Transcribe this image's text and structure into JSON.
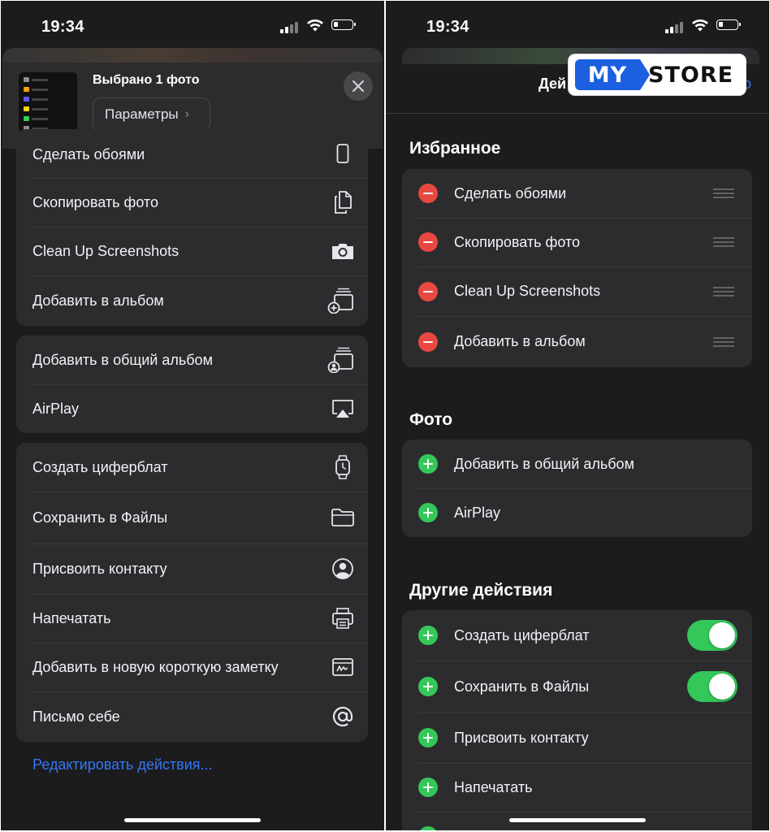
{
  "status": {
    "time": "19:34"
  },
  "share_sheet": {
    "selection_title": "Выбрано 1 фото",
    "params_label": "Параметры",
    "groups": [
      {
        "items": [
          {
            "label": "Сделать обоями",
            "icon": "phone-icon"
          },
          {
            "label": "Скопировать фото",
            "icon": "copy-icon"
          },
          {
            "label": "Clean Up Screenshots",
            "icon": "camera-icon"
          },
          {
            "label": "Добавить в альбом",
            "icon": "add-album-icon"
          }
        ]
      },
      {
        "items": [
          {
            "label": "Добавить в общий альбом",
            "icon": "shared-album-icon"
          },
          {
            "label": "AirPlay",
            "icon": "airplay-icon"
          }
        ]
      },
      {
        "items": [
          {
            "label": "Создать циферблат",
            "icon": "watch-icon"
          },
          {
            "label": "Сохранить в Файлы",
            "icon": "folder-icon"
          },
          {
            "label": "Присвоить контакту",
            "icon": "contact-icon"
          },
          {
            "label": "Напечатать",
            "icon": "printer-icon"
          },
          {
            "label": "Добавить в новую короткую заметку",
            "icon": "quick-note-icon"
          },
          {
            "label": "Письмо себе",
            "icon": "at-icon"
          }
        ]
      }
    ],
    "edit_actions_link": "Редактировать действия..."
  },
  "edit_actions": {
    "nav_title": "Дей",
    "nav_done": "о",
    "sections": [
      {
        "title": "Избранное",
        "items": [
          {
            "label": "Сделать обоями",
            "badge": "minus"
          },
          {
            "label": "Скопировать фото",
            "badge": "minus"
          },
          {
            "label": "Clean Up Screenshots",
            "badge": "minus"
          },
          {
            "label": "Добавить в альбом",
            "badge": "minus"
          }
        ]
      },
      {
        "title": "Фото",
        "items": [
          {
            "label": "Добавить в общий альбом",
            "badge": "plus"
          },
          {
            "label": "AirPlay",
            "badge": "plus"
          }
        ]
      },
      {
        "title": "Другие действия",
        "items": [
          {
            "label": "Создать циферблат",
            "badge": "plus",
            "toggle": true
          },
          {
            "label": "Сохранить в Файлы",
            "badge": "plus",
            "toggle": true
          },
          {
            "label": "Присвоить контакту",
            "badge": "plus"
          },
          {
            "label": "Напечатать",
            "badge": "plus"
          }
        ]
      }
    ]
  },
  "watermark": {
    "part1": "MY",
    "part2": "STORE"
  },
  "colors": {
    "background": "#1c1c1e",
    "cell": "#2c2c2e",
    "link": "#3478f6",
    "remove": "#e8483f",
    "add": "#34c759"
  }
}
